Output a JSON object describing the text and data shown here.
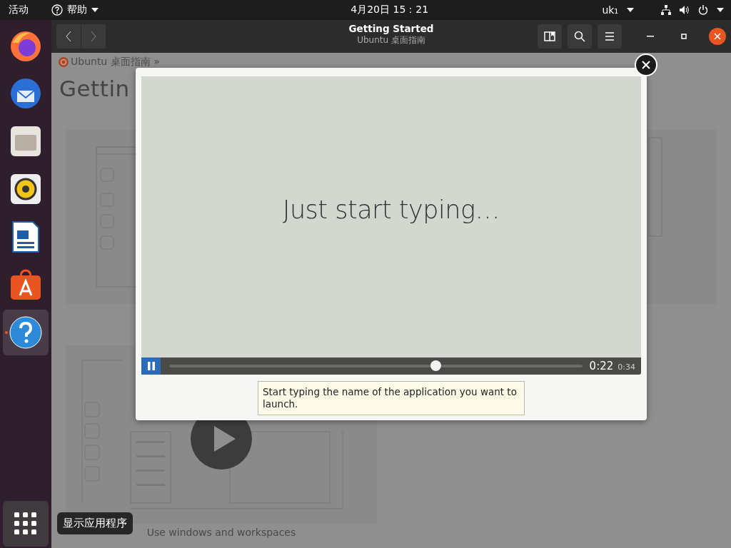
{
  "top_bar": {
    "activities": "活动",
    "app_menu": "帮助",
    "clock": "4月20日  15：21",
    "keyboard": "uk₁"
  },
  "dock": {
    "items": [
      {
        "kind": "firefox",
        "running": false,
        "selected": false
      },
      {
        "kind": "mail",
        "running": false,
        "selected": false
      },
      {
        "kind": "files",
        "running": false,
        "selected": false
      },
      {
        "kind": "music",
        "running": false,
        "selected": false
      },
      {
        "kind": "writer",
        "running": false,
        "selected": false
      },
      {
        "kind": "store",
        "running": false,
        "selected": false
      },
      {
        "kind": "help",
        "running": true,
        "selected": true
      }
    ],
    "tooltip": "显示应用程序"
  },
  "header": {
    "title": "Getting Started",
    "subtitle": "Ubuntu 桌面指南"
  },
  "page": {
    "breadcrumb": "Ubuntu 桌面指南 »",
    "heading": "Gettin",
    "cards": [
      {
        "kind": "sketch"
      },
      {
        "kind": "partial"
      },
      {
        "kind": "video",
        "caption": "Use windows and workspaces"
      }
    ]
  },
  "video": {
    "slide_text": "Just start typing…",
    "playing": true,
    "level": 0.645,
    "position": "0:22",
    "duration": "0:34",
    "caption": "Start typing the name of the application you want to launch."
  }
}
